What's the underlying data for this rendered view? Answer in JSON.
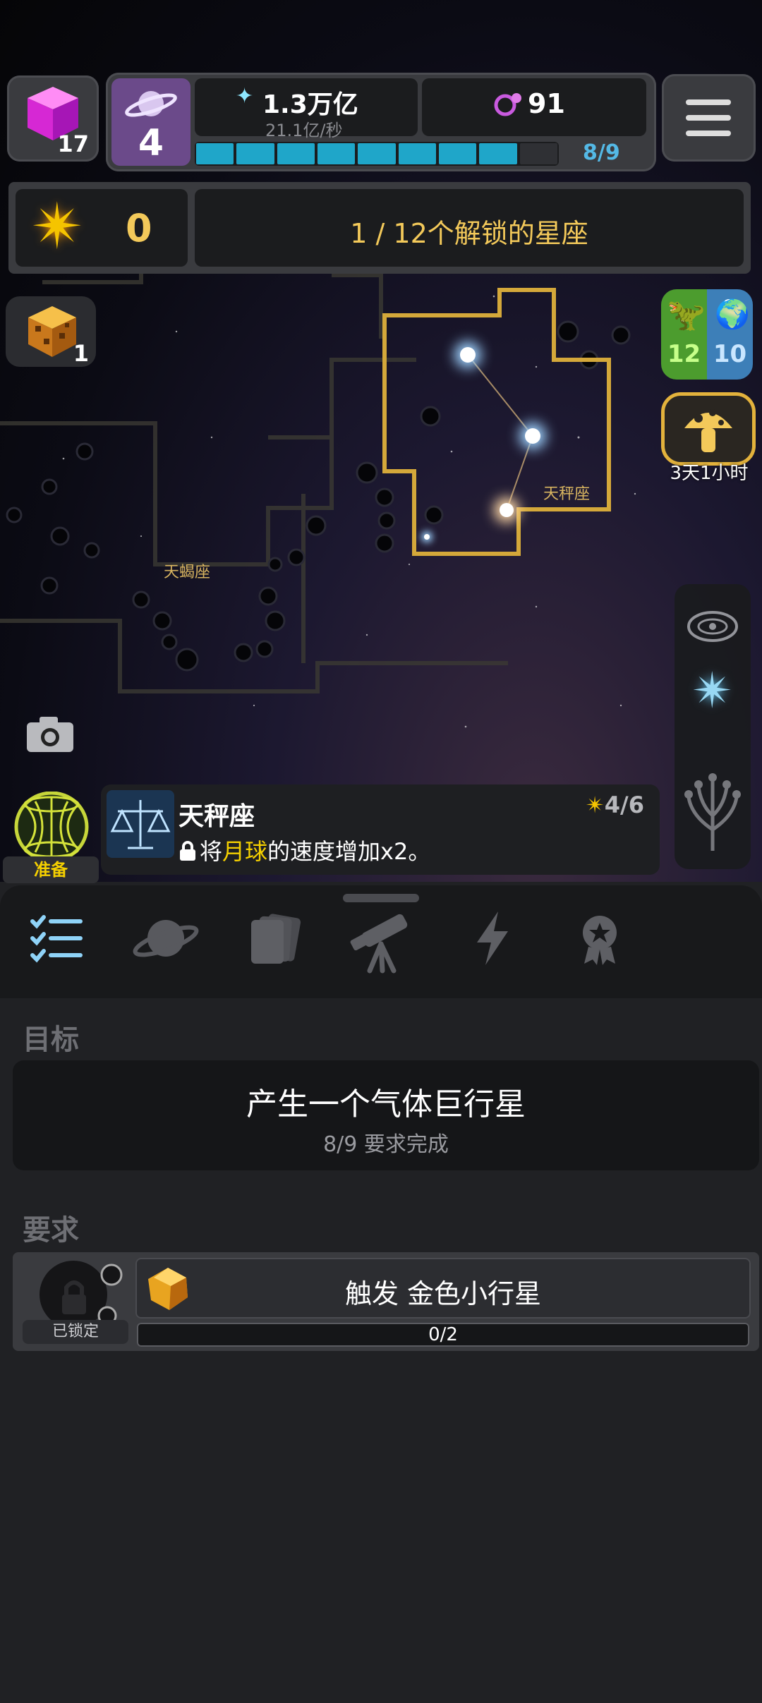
{
  "top": {
    "cube_count": "17",
    "planet_level": "4",
    "stardust_value": "1.3万亿",
    "stardust_rate": "21.1亿/秒",
    "molecule_value": "91",
    "progress_text": "8/9",
    "progress_fraction": 0.889
  },
  "constellation_bar": {
    "star_count": "0",
    "unlocked_text": "1 / 12个解锁的星座"
  },
  "map": {
    "labels": [
      "天秤座",
      "天蝎座"
    ],
    "cube_badge": "1",
    "dino_count": "12",
    "earth_count": "10",
    "mushroom_timer": "3天1小时"
  },
  "info_card": {
    "ready_label": "准备",
    "title": "天秤座",
    "desc_prefix": "将",
    "desc_highlight": "月球",
    "desc_suffix": "的速度增加x2。",
    "stars": "4/6"
  },
  "goal": {
    "section_title": "目标",
    "title": "产生一个气体巨行星",
    "subtitle": "8/9 要求完成"
  },
  "requirement": {
    "section_title": "要求",
    "locked_label": "已锁定",
    "task": "触发 金色小行星",
    "progress": "0/2"
  },
  "colors": {
    "gold": "#f3c95a",
    "progress_blue": "#1fa6c9",
    "accent_yellow": "#f5d000"
  }
}
